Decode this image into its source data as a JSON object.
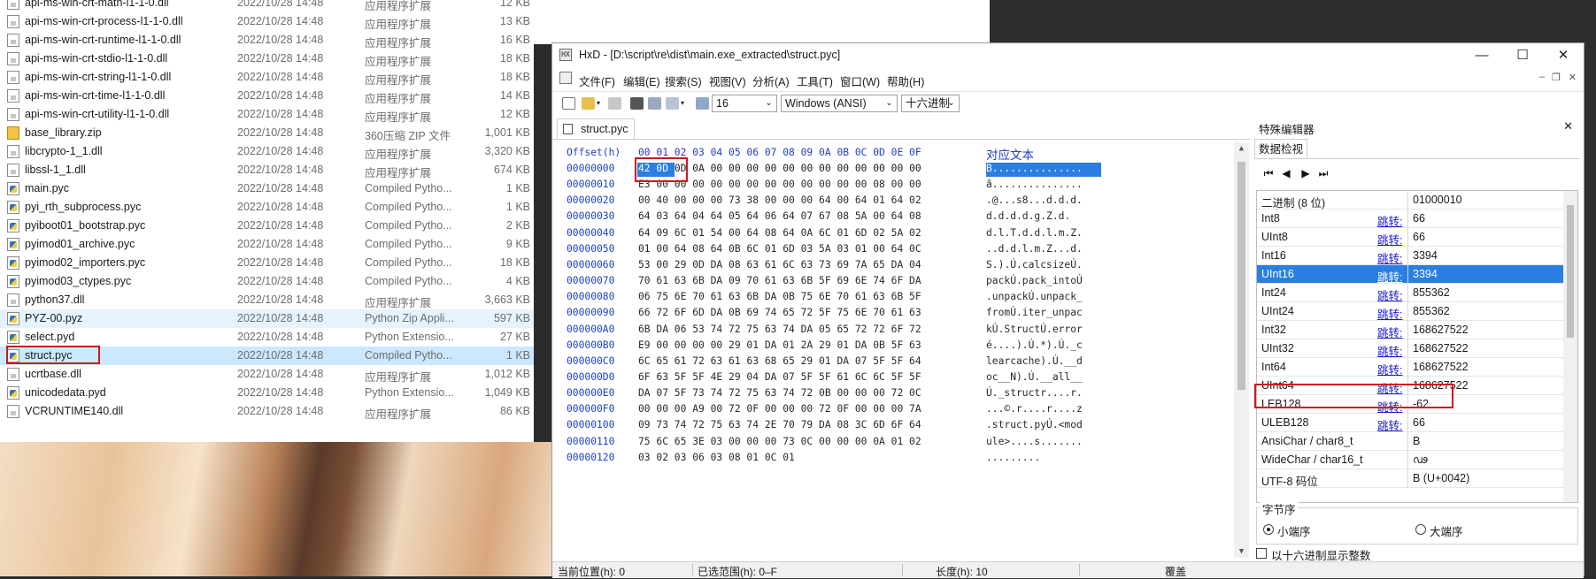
{
  "explorer": {
    "files": [
      {
        "name": "api-ms-win-crt-math-l1-1-0.dll",
        "date": "2022/10/28 14:48",
        "type": "应用程序扩展",
        "size": "12 KB",
        "icon": "dll-file-icon"
      },
      {
        "name": "api-ms-win-crt-process-l1-1-0.dll",
        "date": "2022/10/28 14:48",
        "type": "应用程序扩展",
        "size": "13 KB",
        "icon": "dll-file-icon"
      },
      {
        "name": "api-ms-win-crt-runtime-l1-1-0.dll",
        "date": "2022/10/28 14:48",
        "type": "应用程序扩展",
        "size": "16 KB",
        "icon": "dll-file-icon"
      },
      {
        "name": "api-ms-win-crt-stdio-l1-1-0.dll",
        "date": "2022/10/28 14:48",
        "type": "应用程序扩展",
        "size": "18 KB",
        "icon": "dll-file-icon"
      },
      {
        "name": "api-ms-win-crt-string-l1-1-0.dll",
        "date": "2022/10/28 14:48",
        "type": "应用程序扩展",
        "size": "18 KB",
        "icon": "dll-file-icon"
      },
      {
        "name": "api-ms-win-crt-time-l1-1-0.dll",
        "date": "2022/10/28 14:48",
        "type": "应用程序扩展",
        "size": "14 KB",
        "icon": "dll-file-icon"
      },
      {
        "name": "api-ms-win-crt-utility-l1-1-0.dll",
        "date": "2022/10/28 14:48",
        "type": "应用程序扩展",
        "size": "12 KB",
        "icon": "dll-file-icon"
      },
      {
        "name": "base_library.zip",
        "date": "2022/10/28 14:48",
        "type": "360压缩 ZIP 文件",
        "size": "1,001 KB",
        "icon": "zip-file-icon"
      },
      {
        "name": "libcrypto-1_1.dll",
        "date": "2022/10/28 14:48",
        "type": "应用程序扩展",
        "size": "3,320 KB",
        "icon": "dll-file-icon"
      },
      {
        "name": "libssl-1_1.dll",
        "date": "2022/10/28 14:48",
        "type": "应用程序扩展",
        "size": "674 KB",
        "icon": "dll-file-icon"
      },
      {
        "name": "main.pyc",
        "date": "2022/10/28 14:48",
        "type": "Compiled Pytho...",
        "size": "1 KB",
        "icon": "python-file-icon"
      },
      {
        "name": "pyi_rth_subprocess.pyc",
        "date": "2022/10/28 14:48",
        "type": "Compiled Pytho...",
        "size": "1 KB",
        "icon": "python-file-icon"
      },
      {
        "name": "pyiboot01_bootstrap.pyc",
        "date": "2022/10/28 14:48",
        "type": "Compiled Pytho...",
        "size": "2 KB",
        "icon": "python-file-icon"
      },
      {
        "name": "pyimod01_archive.pyc",
        "date": "2022/10/28 14:48",
        "type": "Compiled Pytho...",
        "size": "9 KB",
        "icon": "python-file-icon"
      },
      {
        "name": "pyimod02_importers.pyc",
        "date": "2022/10/28 14:48",
        "type": "Compiled Pytho...",
        "size": "18 KB",
        "icon": "python-file-icon"
      },
      {
        "name": "pyimod03_ctypes.pyc",
        "date": "2022/10/28 14:48",
        "type": "Compiled Pytho...",
        "size": "4 KB",
        "icon": "python-file-icon"
      },
      {
        "name": "python37.dll",
        "date": "2022/10/28 14:48",
        "type": "应用程序扩展",
        "size": "3,663 KB",
        "icon": "dll-file-icon"
      },
      {
        "name": "PYZ-00.pyz",
        "date": "2022/10/28 14:48",
        "type": "Python Zip Appli...",
        "size": "597 KB",
        "icon": "python-file-icon"
      },
      {
        "name": "select.pyd",
        "date": "2022/10/28 14:48",
        "type": "Python Extensio...",
        "size": "27 KB",
        "icon": "python-file-icon"
      },
      {
        "name": "struct.pyc",
        "date": "2022/10/28 14:48",
        "type": "Compiled Pytho...",
        "size": "1 KB",
        "icon": "python-file-icon"
      },
      {
        "name": "ucrtbase.dll",
        "date": "2022/10/28 14:48",
        "type": "应用程序扩展",
        "size": "1,012 KB",
        "icon": "dll-file-icon"
      },
      {
        "name": "unicodedata.pyd",
        "date": "2022/10/28 14:48",
        "type": "Python Extensio...",
        "size": "1,049 KB",
        "icon": "python-file-icon"
      },
      {
        "name": "VCRUNTIME140.dll",
        "date": "2022/10/28 14:48",
        "type": "应用程序扩展",
        "size": "86 KB",
        "icon": "dll-file-icon"
      }
    ],
    "hover_index": 17,
    "selected_index": 19
  },
  "hxd": {
    "title": "HxD - [D:\\script\\re\\dist\\main.exe_extracted\\struct.pyc]",
    "window_buttons": {
      "minimize": "—",
      "maximize": "☐",
      "close": "✕"
    },
    "menu": [
      "文件(F)",
      "编辑(E)",
      "搜索(S)",
      "视图(V)",
      "分析(A)",
      "工具(T)",
      "窗口(W)",
      "帮助(H)"
    ],
    "toolbar": {
      "bytes_per_row": "16",
      "encoding": "Windows (ANSI)",
      "offset_base": "十六进制"
    },
    "tab_label": "struct.pyc",
    "hex_header": {
      "offset_label": "Offset(h)",
      "columns": "00 01 02 03 04 05 06 07 08 09 0A 0B 0C 0D 0E 0F",
      "text_label": "对应文本"
    },
    "rows": [
      {
        "offset": "00000000",
        "bytes": "42 0D 0D 0A 00 00 00 00 00 00 00 00 00 00 00 00",
        "text": "B..............."
      },
      {
        "offset": "00000010",
        "bytes": "E3 00 00 00 00 00 00 00 00 00 00 00 00 08 00 00",
        "text": "ã..............."
      },
      {
        "offset": "00000020",
        "bytes": "00 40 00 00 00 73 38 00 00 00 64 00 64 01 64 02",
        "text": ".@...s8...d.d.d."
      },
      {
        "offset": "00000030",
        "bytes": "64 03 64 04 64 05 64 06 64 07 67 08 5A 00 64 08",
        "text": "d.d.d.d.g.Z.d."
      },
      {
        "offset": "00000040",
        "bytes": "64 09 6C 01 54 00 64 08 64 0A 6C 01 6D 02 5A 02",
        "text": "d.l.T.d.d.l.m.Z."
      },
      {
        "offset": "00000050",
        "bytes": "01 00 64 08 64 0B 6C 01 6D 03 5A 03 01 00 64 0C",
        "text": "..d.d.l.m.Z...d."
      },
      {
        "offset": "00000060",
        "bytes": "53 00 29 0D DA 08 63 61 6C 63 73 69 7A 65 DA 04",
        "text": "S.).Ú.calcsizeÚ."
      },
      {
        "offset": "00000070",
        "bytes": "70 61 63 6B DA 09 70 61 63 6B 5F 69 6E 74 6F DA",
        "text": "packÚ.pack_intoÚ"
      },
      {
        "offset": "00000080",
        "bytes": "06 75 6E 70 61 63 6B DA 0B 75 6E 70 61 63 6B 5F",
        "text": ".unpackÚ.unpack_"
      },
      {
        "offset": "00000090",
        "bytes": "66 72 6F 6D DA 0B 69 74 65 72 5F 75 6E 70 61 63",
        "text": "fromÚ.iter_unpac"
      },
      {
        "offset": "000000A0",
        "bytes": "6B DA 06 53 74 72 75 63 74 DA 05 65 72 72 6F 72",
        "text": "kÚ.StructÚ.error"
      },
      {
        "offset": "000000B0",
        "bytes": "E9 00 00 00 00 29 01 DA 01 2A 29 01 DA 0B 5F 63",
        "text": "é....).Ú.*).Ú._c"
      },
      {
        "offset": "000000C0",
        "bytes": "6C 65 61 72 63 61 63 68 65 29 01 DA 07 5F 5F 64",
        "text": "learcache).Ú.__d"
      },
      {
        "offset": "000000D0",
        "bytes": "6F 63 5F 5F 4E 29 04 DA 07 5F 5F 61 6C 6C 5F 5F",
        "text": "oc__N).Ú.__all__"
      },
      {
        "offset": "000000E0",
        "bytes": "DA 07 5F 73 74 72 75 63 74 72 0B 00 00 00 72 0C",
        "text": "Ú._structr....r."
      },
      {
        "offset": "000000F0",
        "bytes": "00 00 00 A9 00 72 0F 00 00 00 72 0F 00 00 00 7A",
        "text": "...©.r....r....z"
      },
      {
        "offset": "00000100",
        "bytes": "09 73 74 72 75 63 74 2E 70 79 DA 08 3C 6D 6F 64",
        "text": ".struct.pyÚ.<mod"
      },
      {
        "offset": "00000110",
        "bytes": "75 6C 65 3E 03 00 00 00 73 0C 00 00 00 0A 01 02",
        "text": "ule>....s......."
      },
      {
        "offset": "00000120",
        "bytes": "03 02 03 06 03 08 01 0C 01",
        "text": "........."
      }
    ]
  },
  "inspector": {
    "title": "特殊编辑器",
    "close": "✕",
    "tab": "数据检视",
    "nav_buttons": [
      "⏮",
      "◀",
      "▶",
      "⏭"
    ],
    "jump_label": "跳转:",
    "rows": [
      {
        "name": "二进制 (8 位)",
        "value": "01000010",
        "jump": false
      },
      {
        "name": "Int8",
        "value": "66",
        "jump": true
      },
      {
        "name": "UInt8",
        "value": "66",
        "jump": true
      },
      {
        "name": "Int16",
        "value": "3394",
        "jump": true
      },
      {
        "name": "UInt16",
        "value": "3394",
        "jump": true
      },
      {
        "name": "Int24",
        "value": "855362",
        "jump": true
      },
      {
        "name": "UInt24",
        "value": "855362",
        "jump": true
      },
      {
        "name": "Int32",
        "value": "168627522",
        "jump": true
      },
      {
        "name": "UInt32",
        "value": "168627522",
        "jump": true
      },
      {
        "name": "Int64",
        "value": "168627522",
        "jump": true
      },
      {
        "name": "UInt64",
        "value": "168627522",
        "jump": true
      },
      {
        "name": "LEB128",
        "value": "-62",
        "jump": true
      },
      {
        "name": "ULEB128",
        "value": "66",
        "jump": true
      },
      {
        "name": "AnsiChar / char8_t",
        "value": "B",
        "jump": false
      },
      {
        "name": "WideChar / char16_t",
        "value": "ഢ",
        "jump": false
      },
      {
        "name": "UTF-8 码位",
        "value": "B (U+0042)",
        "jump": false
      }
    ],
    "selected_index": 4,
    "endianness": {
      "legend": "字节序",
      "little": "小端序",
      "big": "大端序",
      "selected": "little"
    },
    "hex_ints_label": "以十六进制显示整数"
  },
  "status": {
    "position": "当前位置(h): 0",
    "selection": "已选范围(h): 0–F",
    "length": "长度(h): 10",
    "mode": "覆盖"
  },
  "colors": {
    "selection": "#2a7fe0",
    "highlight_box": "#d0161c",
    "offset_blue": "#1f3fc5"
  }
}
